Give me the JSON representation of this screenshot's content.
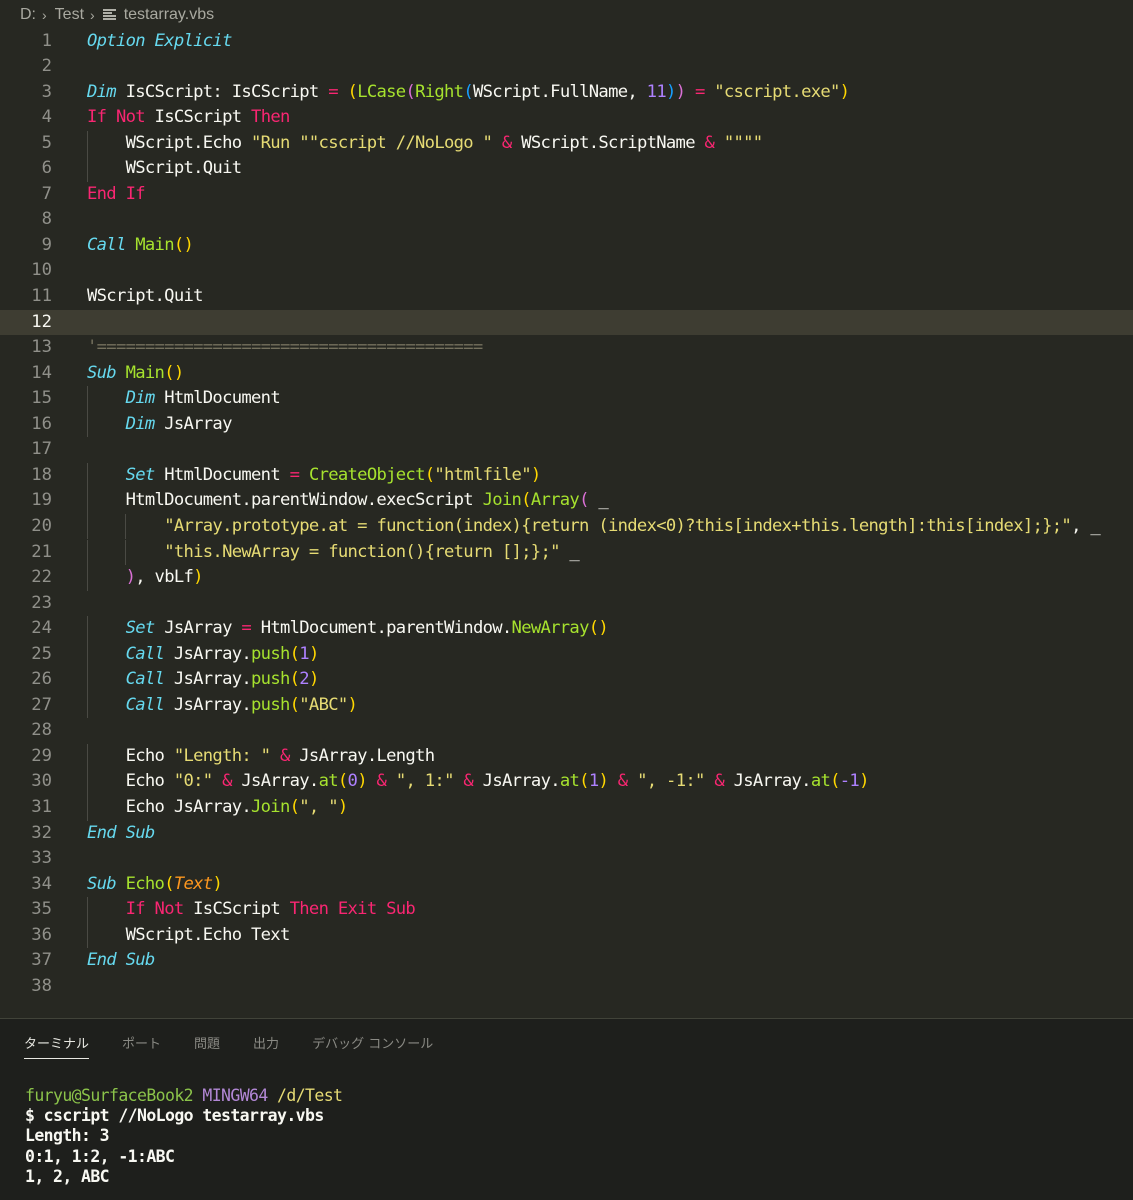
{
  "breadcrumb": {
    "drive": "D:",
    "folder": "Test",
    "file": "testarray.vbs"
  },
  "editor": {
    "current_line": 12,
    "lines": [
      [
        {
          "t": "Option Explicit",
          "c": "kwi"
        }
      ],
      [],
      [
        {
          "t": "Dim",
          "c": "kwi"
        },
        {
          "t": " IsCScript: IsCScript ",
          "c": "pl"
        },
        {
          "t": "=",
          "c": "op"
        },
        {
          "t": " ",
          "c": "pl"
        },
        {
          "t": "(",
          "c": "b1"
        },
        {
          "t": "LCase",
          "c": "fn"
        },
        {
          "t": "(",
          "c": "b2"
        },
        {
          "t": "Right",
          "c": "fn"
        },
        {
          "t": "(",
          "c": "b3"
        },
        {
          "t": "WScript.FullName, ",
          "c": "pl"
        },
        {
          "t": "11",
          "c": "num"
        },
        {
          "t": ")",
          "c": "b3"
        },
        {
          "t": ")",
          "c": "b2"
        },
        {
          "t": " ",
          "c": "pl"
        },
        {
          "t": "=",
          "c": "op"
        },
        {
          "t": " ",
          "c": "pl"
        },
        {
          "t": "\"cscript.exe\"",
          "c": "str"
        },
        {
          "t": ")",
          "c": "b1"
        }
      ],
      [
        {
          "t": "If",
          "c": "kw"
        },
        {
          "t": " ",
          "c": "pl"
        },
        {
          "t": "Not",
          "c": "kw"
        },
        {
          "t": " IsCScript ",
          "c": "pl"
        },
        {
          "t": "Then",
          "c": "kw"
        }
      ],
      [
        {
          "t": "    WScript.Echo ",
          "c": "pl"
        },
        {
          "t": "\"Run \"\"cscript //NoLogo \"",
          "c": "str"
        },
        {
          "t": " ",
          "c": "pl"
        },
        {
          "t": "&",
          "c": "op"
        },
        {
          "t": " WScript.ScriptName ",
          "c": "pl"
        },
        {
          "t": "&",
          "c": "op"
        },
        {
          "t": " ",
          "c": "pl"
        },
        {
          "t": "\"\"\"\"",
          "c": "str"
        }
      ],
      [
        {
          "t": "    WScript.Quit",
          "c": "pl"
        }
      ],
      [
        {
          "t": "End",
          "c": "kw"
        },
        {
          "t": " ",
          "c": "pl"
        },
        {
          "t": "If",
          "c": "kw"
        }
      ],
      [],
      [
        {
          "t": "Call",
          "c": "kwi"
        },
        {
          "t": " ",
          "c": "pl"
        },
        {
          "t": "Main",
          "c": "fn"
        },
        {
          "t": "()",
          "c": "b1"
        }
      ],
      [],
      [
        {
          "t": "WScript.Quit",
          "c": "pl"
        }
      ],
      [],
      [
        {
          "t": "'========================================",
          "c": "cm"
        }
      ],
      [
        {
          "t": "Sub",
          "c": "kwi"
        },
        {
          "t": " ",
          "c": "pl"
        },
        {
          "t": "Main",
          "c": "fn"
        },
        {
          "t": "()",
          "c": "b1"
        }
      ],
      [
        {
          "t": "    ",
          "c": "pl"
        },
        {
          "t": "Dim",
          "c": "kwi"
        },
        {
          "t": " HtmlDocument",
          "c": "pl"
        }
      ],
      [
        {
          "t": "    ",
          "c": "pl"
        },
        {
          "t": "Dim",
          "c": "kwi"
        },
        {
          "t": " JsArray",
          "c": "pl"
        }
      ],
      [],
      [
        {
          "t": "    ",
          "c": "pl"
        },
        {
          "t": "Set",
          "c": "kwi"
        },
        {
          "t": " HtmlDocument ",
          "c": "pl"
        },
        {
          "t": "=",
          "c": "op"
        },
        {
          "t": " ",
          "c": "pl"
        },
        {
          "t": "CreateObject",
          "c": "fn"
        },
        {
          "t": "(",
          "c": "b1"
        },
        {
          "t": "\"htmlfile\"",
          "c": "str"
        },
        {
          "t": ")",
          "c": "b1"
        }
      ],
      [
        {
          "t": "    HtmlDocument.parentWindow.execScript ",
          "c": "pl"
        },
        {
          "t": "Join",
          "c": "fn"
        },
        {
          "t": "(",
          "c": "b1"
        },
        {
          "t": "Array",
          "c": "fn"
        },
        {
          "t": "(",
          "c": "b2"
        },
        {
          "t": " _",
          "c": "pl"
        }
      ],
      [
        {
          "t": "        ",
          "c": "pl"
        },
        {
          "t": "\"Array.prototype.at = function(index){return (index<0)?this[index+this.length]:this[index];};\"",
          "c": "str"
        },
        {
          "t": ", _",
          "c": "pl"
        }
      ],
      [
        {
          "t": "        ",
          "c": "pl"
        },
        {
          "t": "\"this.NewArray = function(){return [];};\"",
          "c": "str"
        },
        {
          "t": " _",
          "c": "pl"
        }
      ],
      [
        {
          "t": "    ",
          "c": "pl"
        },
        {
          "t": ")",
          "c": "b2"
        },
        {
          "t": ", vbLf",
          "c": "pl"
        },
        {
          "t": ")",
          "c": "b1"
        }
      ],
      [],
      [
        {
          "t": "    ",
          "c": "pl"
        },
        {
          "t": "Set",
          "c": "kwi"
        },
        {
          "t": " JsArray ",
          "c": "pl"
        },
        {
          "t": "=",
          "c": "op"
        },
        {
          "t": " HtmlDocument.parentWindow.",
          "c": "pl"
        },
        {
          "t": "NewArray",
          "c": "fn"
        },
        {
          "t": "()",
          "c": "b1"
        }
      ],
      [
        {
          "t": "    ",
          "c": "pl"
        },
        {
          "t": "Call",
          "c": "kwi"
        },
        {
          "t": " JsArray.",
          "c": "pl"
        },
        {
          "t": "push",
          "c": "fn"
        },
        {
          "t": "(",
          "c": "b1"
        },
        {
          "t": "1",
          "c": "num"
        },
        {
          "t": ")",
          "c": "b1"
        }
      ],
      [
        {
          "t": "    ",
          "c": "pl"
        },
        {
          "t": "Call",
          "c": "kwi"
        },
        {
          "t": " JsArray.",
          "c": "pl"
        },
        {
          "t": "push",
          "c": "fn"
        },
        {
          "t": "(",
          "c": "b1"
        },
        {
          "t": "2",
          "c": "num"
        },
        {
          "t": ")",
          "c": "b1"
        }
      ],
      [
        {
          "t": "    ",
          "c": "pl"
        },
        {
          "t": "Call",
          "c": "kwi"
        },
        {
          "t": " JsArray.",
          "c": "pl"
        },
        {
          "t": "push",
          "c": "fn"
        },
        {
          "t": "(",
          "c": "b1"
        },
        {
          "t": "\"ABC\"",
          "c": "str"
        },
        {
          "t": ")",
          "c": "b1"
        }
      ],
      [],
      [
        {
          "t": "    Echo ",
          "c": "pl"
        },
        {
          "t": "\"Length: \"",
          "c": "str"
        },
        {
          "t": " ",
          "c": "pl"
        },
        {
          "t": "&",
          "c": "op"
        },
        {
          "t": " JsArray.Length",
          "c": "pl"
        }
      ],
      [
        {
          "t": "    Echo ",
          "c": "pl"
        },
        {
          "t": "\"0:\"",
          "c": "str"
        },
        {
          "t": " ",
          "c": "pl"
        },
        {
          "t": "&",
          "c": "op"
        },
        {
          "t": " JsArray.",
          "c": "pl"
        },
        {
          "t": "at",
          "c": "fn"
        },
        {
          "t": "(",
          "c": "b1"
        },
        {
          "t": "0",
          "c": "num"
        },
        {
          "t": ")",
          "c": "b1"
        },
        {
          "t": " ",
          "c": "pl"
        },
        {
          "t": "&",
          "c": "op"
        },
        {
          "t": " ",
          "c": "pl"
        },
        {
          "t": "\", 1:\"",
          "c": "str"
        },
        {
          "t": " ",
          "c": "pl"
        },
        {
          "t": "&",
          "c": "op"
        },
        {
          "t": " JsArray.",
          "c": "pl"
        },
        {
          "t": "at",
          "c": "fn"
        },
        {
          "t": "(",
          "c": "b1"
        },
        {
          "t": "1",
          "c": "num"
        },
        {
          "t": ")",
          "c": "b1"
        },
        {
          "t": " ",
          "c": "pl"
        },
        {
          "t": "&",
          "c": "op"
        },
        {
          "t": " ",
          "c": "pl"
        },
        {
          "t": "\", -1:\"",
          "c": "str"
        },
        {
          "t": " ",
          "c": "pl"
        },
        {
          "t": "&",
          "c": "op"
        },
        {
          "t": " JsArray.",
          "c": "pl"
        },
        {
          "t": "at",
          "c": "fn"
        },
        {
          "t": "(",
          "c": "b1"
        },
        {
          "t": "-1",
          "c": "num"
        },
        {
          "t": ")",
          "c": "b1"
        }
      ],
      [
        {
          "t": "    Echo JsArray.",
          "c": "pl"
        },
        {
          "t": "Join",
          "c": "fn"
        },
        {
          "t": "(",
          "c": "b1"
        },
        {
          "t": "\", \"",
          "c": "str"
        },
        {
          "t": ")",
          "c": "b1"
        }
      ],
      [
        {
          "t": "End",
          "c": "kwi"
        },
        {
          "t": " ",
          "c": "pl"
        },
        {
          "t": "Sub",
          "c": "kwi"
        }
      ],
      [],
      [
        {
          "t": "Sub",
          "c": "kwi"
        },
        {
          "t": " ",
          "c": "pl"
        },
        {
          "t": "Echo",
          "c": "fn"
        },
        {
          "t": "(",
          "c": "b1"
        },
        {
          "t": "Text",
          "c": "par"
        },
        {
          "t": ")",
          "c": "b1"
        }
      ],
      [
        {
          "t": "    ",
          "c": "pl"
        },
        {
          "t": "If",
          "c": "kw"
        },
        {
          "t": " ",
          "c": "pl"
        },
        {
          "t": "Not",
          "c": "kw"
        },
        {
          "t": " IsCScript ",
          "c": "pl"
        },
        {
          "t": "Then",
          "c": "kw"
        },
        {
          "t": " ",
          "c": "pl"
        },
        {
          "t": "Exit",
          "c": "kw"
        },
        {
          "t": " ",
          "c": "pl"
        },
        {
          "t": "Sub",
          "c": "kw"
        }
      ],
      [
        {
          "t": "    WScript.Echo Text",
          "c": "pl"
        }
      ],
      [
        {
          "t": "End",
          "c": "kwi"
        },
        {
          "t": " ",
          "c": "pl"
        },
        {
          "t": "Sub",
          "c": "kwi"
        }
      ],
      []
    ]
  },
  "panel": {
    "tabs": [
      "ターミナル",
      "ポート",
      "問題",
      "出力",
      "デバッグ コンソール"
    ],
    "active_tab": 0,
    "terminal": {
      "prompt_user": "furyu@SurfaceBook2",
      "prompt_host": "MINGW64",
      "prompt_path": "/d/Test",
      "command": "$ cscript //NoLogo testarray.vbs",
      "output": [
        "Length: 3",
        "0:1, 1:2, -1:ABC",
        "1, 2, ABC"
      ]
    }
  }
}
